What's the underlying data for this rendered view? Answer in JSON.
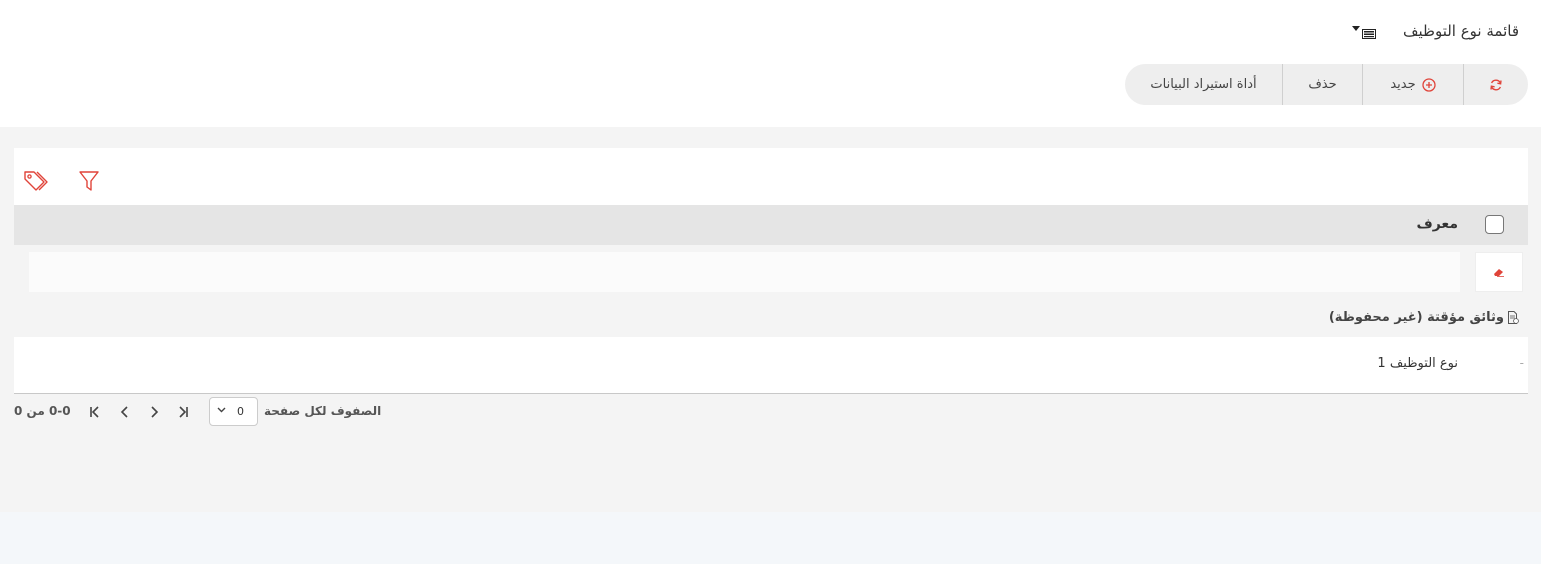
{
  "page": {
    "title": "قائمة نوع التوظيف",
    "view_icon": "list-view-icon"
  },
  "toolbar": {
    "import_label": "أداة استيراد البيانات",
    "delete_label": "حذف",
    "new_label": "جديد",
    "new_icon": "plus-circle-icon",
    "refresh_icon": "refresh-icon"
  },
  "filters": {
    "tag_icon": "tags-icon",
    "filter_icon": "funnel-icon"
  },
  "table": {
    "column_header": "معرف",
    "filter_value": "",
    "clear_icon": "eraser-icon"
  },
  "temp_docs": {
    "heading": "وثائق مؤقتة (غير محفوظة)",
    "icon": "document-icon",
    "rows": [
      {
        "marker": "-",
        "label": "نوع التوظيف 1"
      }
    ]
  },
  "pager": {
    "range": "0-0 من 0",
    "rows_per_page_label": "الصفوف لكل صفحة",
    "rows_per_page_value": "0"
  },
  "colors": {
    "accent": "#e0443a",
    "toolbar_bg": "#eeeeee",
    "header_bg": "#e5e5e5"
  }
}
